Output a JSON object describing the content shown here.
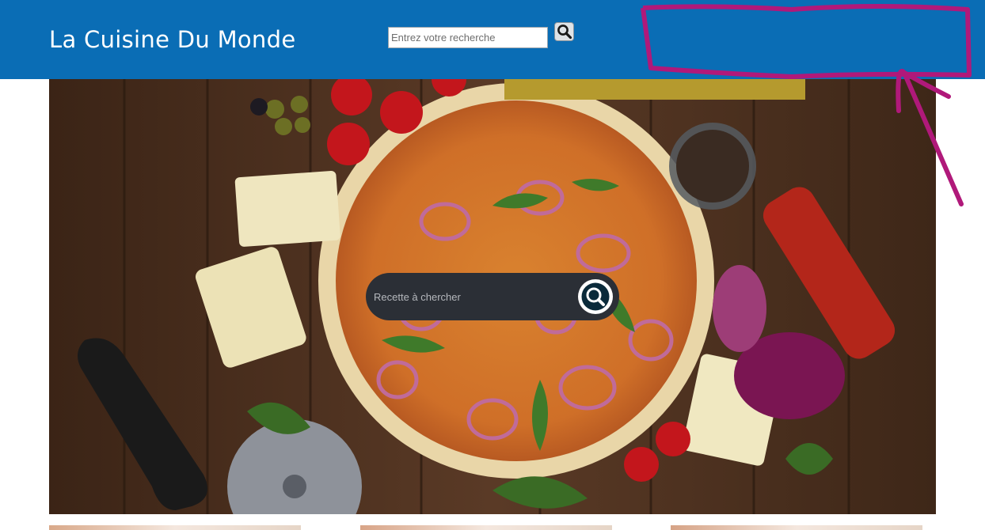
{
  "header": {
    "title": "La Cuisine Du Monde",
    "search_placeholder": "Entrez votre recherche",
    "search_button_icon": "search-icon",
    "background_color": "#0a6db5"
  },
  "hero": {
    "search_placeholder": "Recette à chercher",
    "search_button_icon": "search-icon",
    "image_subject": "pizza with onions, tomatoes, cheese, herbs and pizza cutter on wooden table"
  },
  "annotation": {
    "color": "#b0197a",
    "shape": "hand-drawn rectangle with arrow"
  },
  "recipe_strip": {
    "card_count": 3
  }
}
